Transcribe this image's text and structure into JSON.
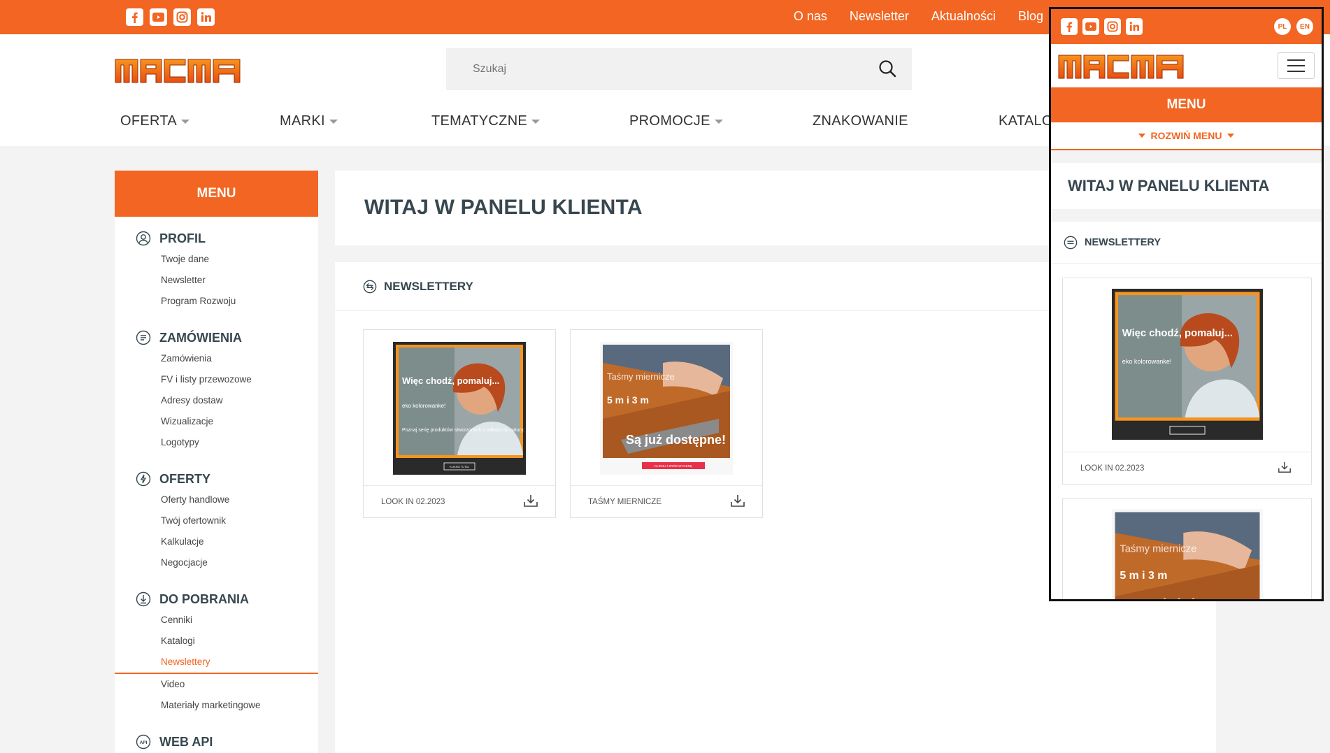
{
  "colors": {
    "accent": "#f26522",
    "dark_heading": "#37474f"
  },
  "top_bar": {
    "social_icons": [
      "facebook-icon",
      "youtube-icon",
      "instagram-icon",
      "linkedin-icon"
    ],
    "links": [
      "O nas",
      "Newsletter",
      "Aktualności",
      "Blog"
    ]
  },
  "header": {
    "logo_text": "MACMA",
    "search_placeholder": "Szukaj"
  },
  "main_nav": {
    "items": [
      {
        "label": "OFERTA",
        "dropdown": true
      },
      {
        "label": "MARKI",
        "dropdown": true
      },
      {
        "label": "TEMATYCZNE",
        "dropdown": true
      },
      {
        "label": "PROMOCJE",
        "dropdown": true
      },
      {
        "label": "ZNAKOWANIE",
        "dropdown": false
      },
      {
        "label": "KATALO",
        "dropdown": false
      }
    ]
  },
  "sidebar": {
    "heading": "MENU",
    "groups": [
      {
        "title": "PROFIL",
        "icon": "user-circle-icon",
        "items": [
          "Twoje dane",
          "Newsletter",
          "Program Rozwoju"
        ]
      },
      {
        "title": "ZAMÓWIENIA",
        "icon": "orders-icon",
        "items": [
          "Zamówienia",
          "FV i listy przewozowe",
          "Adresy dostaw",
          "Wizualizacje",
          "Logotypy"
        ]
      },
      {
        "title": "OFERTY",
        "icon": "offers-icon",
        "items": [
          "Oferty handlowe",
          "Twój ofertownik",
          "Kalkulacje",
          "Negocjacje"
        ]
      },
      {
        "title": "DO POBRANIA",
        "icon": "download-circle-icon",
        "items": [
          "Cenniki",
          "Katalogi",
          "Newslettery",
          "Video",
          "Materiały marketingowe"
        ],
        "active_item": "Newslettery"
      },
      {
        "title": "WEB API",
        "icon": "api-icon",
        "items": []
      }
    ]
  },
  "main": {
    "title": "WITAJ W PANELU KLIENTA",
    "section": "NEWSLETTERY",
    "cards": [
      {
        "label": "LOOK IN 02.2023",
        "image": {
          "headline": "Więc chodź, pomaluj...",
          "sub": "eko kolorowanke!",
          "body": "Poznaj serię produktów stworzonych z miłości do natury.",
          "cta": "KLIKNIJ TUTAJ"
        }
      },
      {
        "label": "TAŚMY MIERNICZE",
        "image": {
          "headline": "Taśmy miernicze",
          "sub": "5 m i 3 m",
          "body": "Są już dostępne!",
          "cta": "KLIKNIJ I ZRÓB WYCENĘ"
        }
      }
    ]
  },
  "mobile": {
    "lang": [
      "PL",
      "EN"
    ],
    "menu": "MENU",
    "expand": "ROZWIŃ MENU",
    "title": "WITAJ W PANELU KLIENTA",
    "section": "NEWSLETTERY",
    "card_label": "LOOK IN 02.2023"
  }
}
